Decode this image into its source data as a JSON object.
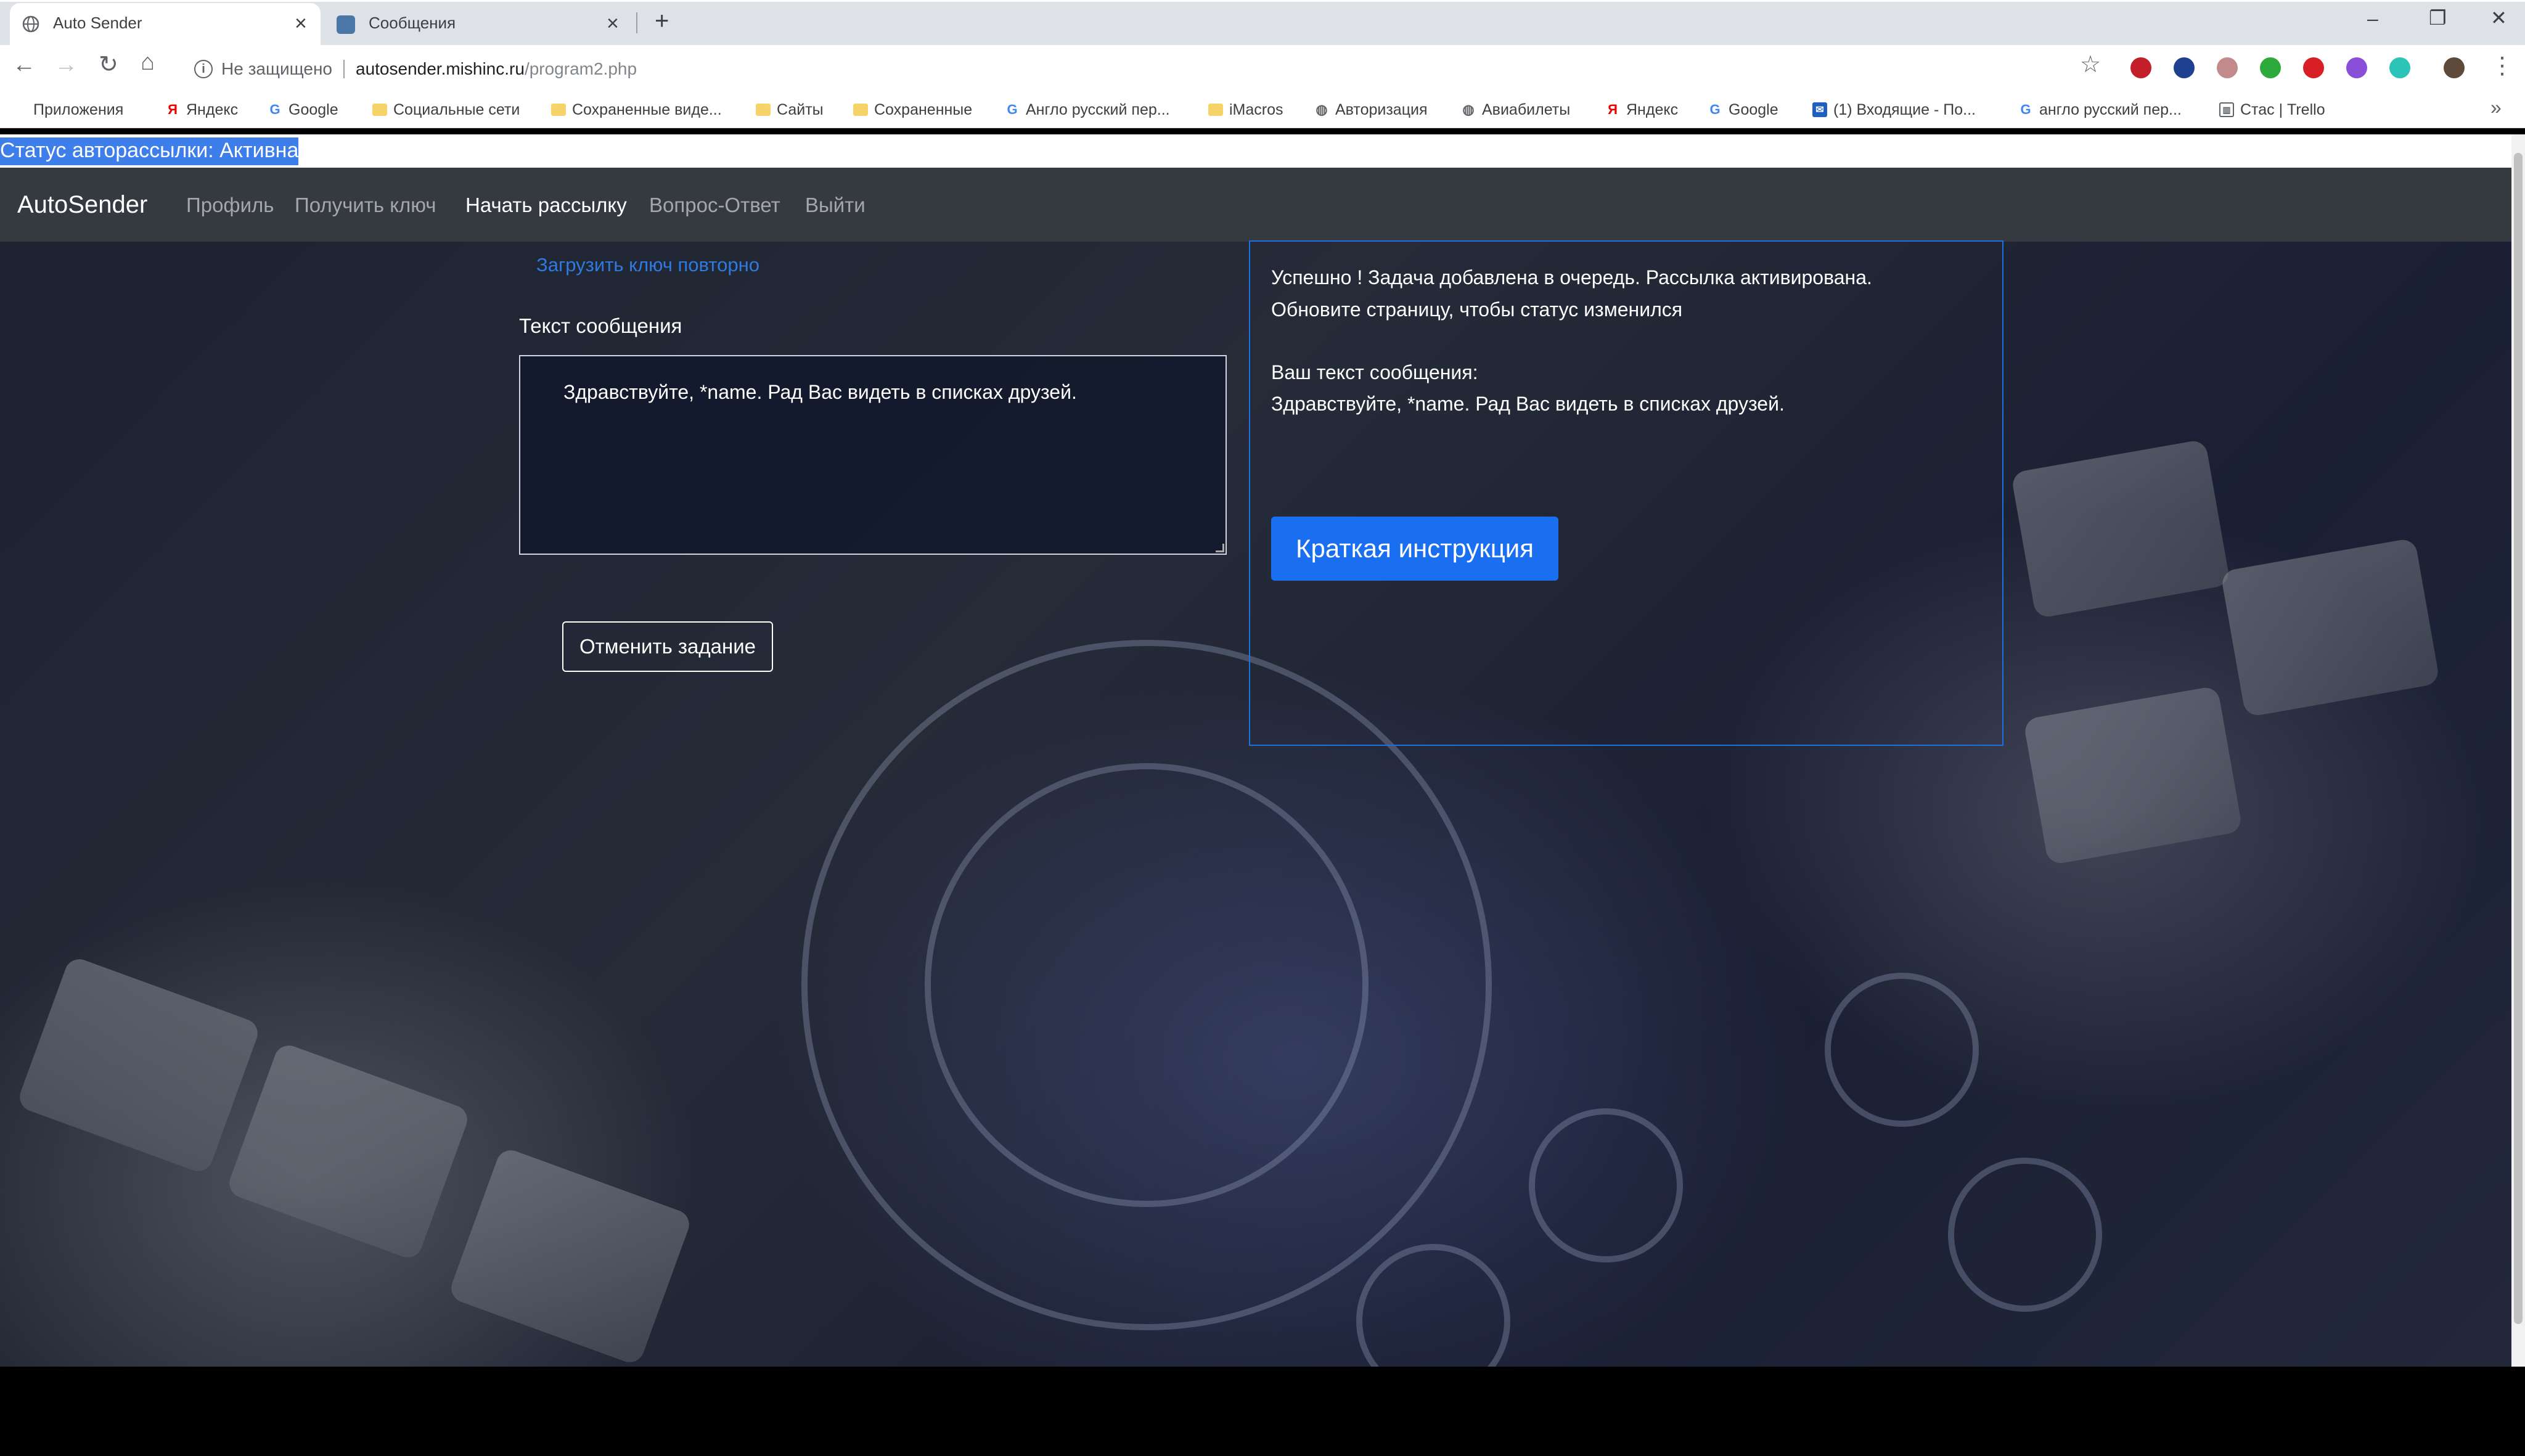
{
  "browser": {
    "tabs": [
      {
        "title": "Auto Sender",
        "active": true,
        "icon": "globe-icon"
      },
      {
        "title": "Сообщения",
        "active": false,
        "icon": "vk-icon"
      }
    ],
    "new_tab": "+",
    "window_controls": {
      "minimize": "–",
      "restore": "❐",
      "close": "✕"
    },
    "nav": {
      "back": "←",
      "forward": "→",
      "reload": "↻",
      "home": "⌂"
    },
    "address": {
      "security": "Не защищено",
      "host": "autosender.mishinc.ru",
      "path": "/program2.php"
    },
    "star": "☆",
    "menu": "⋮",
    "bookmarks": [
      {
        "label": "Приложения",
        "icon": "apps-grid-icon"
      },
      {
        "label": "Яндекс",
        "icon": "yandex-icon"
      },
      {
        "label": "Google",
        "icon": "google-icon"
      },
      {
        "label": "Социальные сети",
        "icon": "folder-icon"
      },
      {
        "label": "Сохраненные виде...",
        "icon": "folder-icon"
      },
      {
        "label": "Сайты",
        "icon": "folder-icon"
      },
      {
        "label": "Сохраненные",
        "icon": "folder-icon"
      },
      {
        "label": "Англо русский пер...",
        "icon": "google-icon"
      },
      {
        "label": "iMacros",
        "icon": "folder-icon"
      },
      {
        "label": "Авторизация",
        "icon": "globe-icon"
      },
      {
        "label": "Авиабилеты",
        "icon": "globe-icon"
      },
      {
        "label": "Яндекс",
        "icon": "yandex-icon"
      },
      {
        "label": "Google",
        "icon": "google-icon"
      },
      {
        "label": "(1) Входящие - По...",
        "icon": "mail-icon"
      },
      {
        "label": "англо русский пер...",
        "icon": "google-icon"
      },
      {
        "label": "Стас | Trello",
        "icon": "trello-icon"
      }
    ],
    "bookmarks_more": "»"
  },
  "page": {
    "status": "Статус авторассылки: Активна",
    "navbar": {
      "brand": "AutoSender",
      "links": [
        "Профиль",
        "Получить ключ",
        "Начать рассылку",
        "Вопрос-Ответ",
        "Выйти"
      ]
    },
    "reload_key_link": "Загрузить ключ повторно",
    "message_label": "Текст сообщения",
    "message_value": "Здравствуйте, *name. Рад Вас видеть в списках друзей.",
    "cancel_button": "Отменить задание",
    "panel": {
      "success_line1": "Успешно ! Задача добавлена в очередь. Рассылка активирована.",
      "success_line2": "Обновите страницу, чтобы статус изменился",
      "your_text_label": "Ваш текст сообщения:",
      "your_text_value": "Здравствуйте, *name. Рад Вас видеть в списках друзей.",
      "guide_button": "Краткая инструкция"
    }
  },
  "colors": {
    "accent": "#1a6ff0",
    "navbar": "#353a40",
    "status_highlight": "#3d7eea"
  }
}
